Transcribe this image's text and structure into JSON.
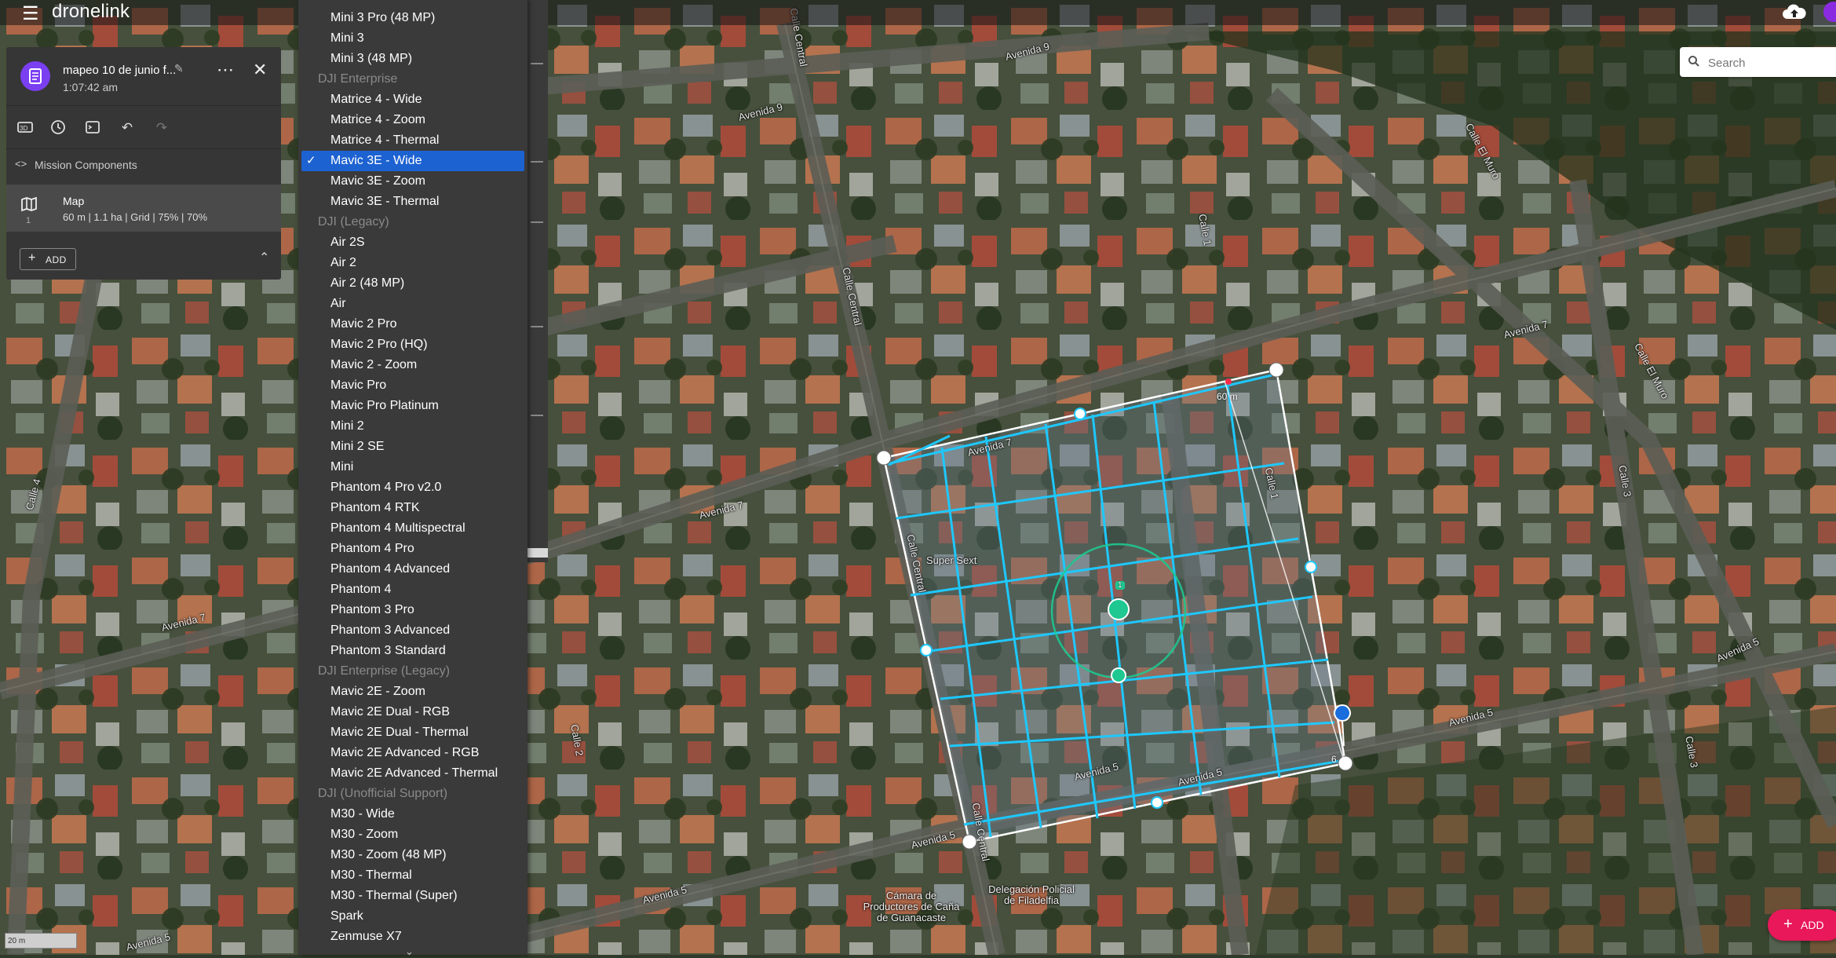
{
  "app": {
    "name": "dronelink"
  },
  "search": {
    "placeholder": "Search"
  },
  "mission": {
    "title": "mapeo 10 de junio f...",
    "time": "1:07:42 am",
    "components_label": "Mission Components",
    "component": {
      "index": "1",
      "title": "Map",
      "detail": "60 m | 1.1 ha | Grid | 75% | 70%"
    },
    "add_label": "ADD"
  },
  "drone_menu": {
    "selected": "Mavic 3E - Wide",
    "items": [
      {
        "kind": "item",
        "label": "Mini 3 Pro (48 MP)"
      },
      {
        "kind": "item",
        "label": "Mini 3"
      },
      {
        "kind": "item",
        "label": "Mini 3 (48 MP)"
      },
      {
        "kind": "group",
        "label": "DJI Enterprise"
      },
      {
        "kind": "item",
        "label": "Matrice 4 - Wide"
      },
      {
        "kind": "item",
        "label": "Matrice 4 - Zoom"
      },
      {
        "kind": "item",
        "label": "Matrice 4 - Thermal"
      },
      {
        "kind": "item",
        "label": "Mavic 3E - Wide",
        "selected": true
      },
      {
        "kind": "item",
        "label": "Mavic 3E - Zoom"
      },
      {
        "kind": "item",
        "label": "Mavic 3E - Thermal"
      },
      {
        "kind": "group",
        "label": "DJI (Legacy)"
      },
      {
        "kind": "item",
        "label": "Air 2S"
      },
      {
        "kind": "item",
        "label": "Air 2"
      },
      {
        "kind": "item",
        "label": "Air 2 (48 MP)"
      },
      {
        "kind": "item",
        "label": "Air"
      },
      {
        "kind": "item",
        "label": "Mavic 2 Pro"
      },
      {
        "kind": "item",
        "label": "Mavic 2 Pro (HQ)"
      },
      {
        "kind": "item",
        "label": "Mavic 2 - Zoom"
      },
      {
        "kind": "item",
        "label": "Mavic Pro"
      },
      {
        "kind": "item",
        "label": "Mavic Pro Platinum"
      },
      {
        "kind": "item",
        "label": "Mini 2"
      },
      {
        "kind": "item",
        "label": "Mini 2 SE"
      },
      {
        "kind": "item",
        "label": "Mini"
      },
      {
        "kind": "item",
        "label": "Phantom 4 Pro v2.0"
      },
      {
        "kind": "item",
        "label": "Phantom 4 RTK"
      },
      {
        "kind": "item",
        "label": "Phantom 4 Multispectral"
      },
      {
        "kind": "item",
        "label": "Phantom 4 Pro"
      },
      {
        "kind": "item",
        "label": "Phantom 4 Advanced"
      },
      {
        "kind": "item",
        "label": "Phantom 4"
      },
      {
        "kind": "item",
        "label": "Phantom 3 Pro"
      },
      {
        "kind": "item",
        "label": "Phantom 3 Advanced"
      },
      {
        "kind": "item",
        "label": "Phantom 3 Standard"
      },
      {
        "kind": "group",
        "label": "DJI Enterprise (Legacy)"
      },
      {
        "kind": "item",
        "label": "Mavic 2E - Zoom"
      },
      {
        "kind": "item",
        "label": "Mavic 2E Dual - RGB"
      },
      {
        "kind": "item",
        "label": "Mavic 2E Dual - Thermal"
      },
      {
        "kind": "item",
        "label": "Mavic 2E Advanced - RGB"
      },
      {
        "kind": "item",
        "label": "Mavic 2E Advanced - Thermal"
      },
      {
        "kind": "group",
        "label": "DJI (Unofficial Support)"
      },
      {
        "kind": "item",
        "label": "M30 - Wide"
      },
      {
        "kind": "item",
        "label": "M30 - Zoom"
      },
      {
        "kind": "item",
        "label": "M30 - Zoom (48 MP)"
      },
      {
        "kind": "item",
        "label": "M30 - Thermal"
      },
      {
        "kind": "item",
        "label": "M30 - Thermal (Super)"
      },
      {
        "kind": "item",
        "label": "Spark"
      },
      {
        "kind": "item",
        "label": "Zenmuse X7"
      }
    ]
  },
  "map_overlay": {
    "altitude_label": "60 m",
    "edge_label": "6",
    "waypoint_number": "1",
    "scale_label": "20 m",
    "add_label": "ADD"
  },
  "streets": [
    "Avenida 9",
    "Avenida 9",
    "Calle Central",
    "Calle Central",
    "Calle 1",
    "Calle El Muro",
    "Avenida 7",
    "Calle El Muro",
    "Avenida 7",
    "Calle 4",
    "Avenida 7",
    "Avenida 7",
    "Calle 1",
    "Calle 3",
    "Calle Central",
    "Super Sext",
    "Avenida 5",
    "Avenida 5",
    "Avenida 5",
    "Avenida 5",
    "Avenida 5",
    "Calle 2",
    "Calle Central",
    "Calle 3",
    "Avenida 5",
    "Avenida 5"
  ],
  "pois": [
    "Cámara de Productores de Caña de Guanacaste",
    "Delegación Policial de Filadelfia"
  ],
  "colors": {
    "accent_selected": "#1d62d1",
    "flight_line": "#1ec8ff",
    "mission_icon": "#7b3ff2",
    "fab": "#e8185a"
  }
}
